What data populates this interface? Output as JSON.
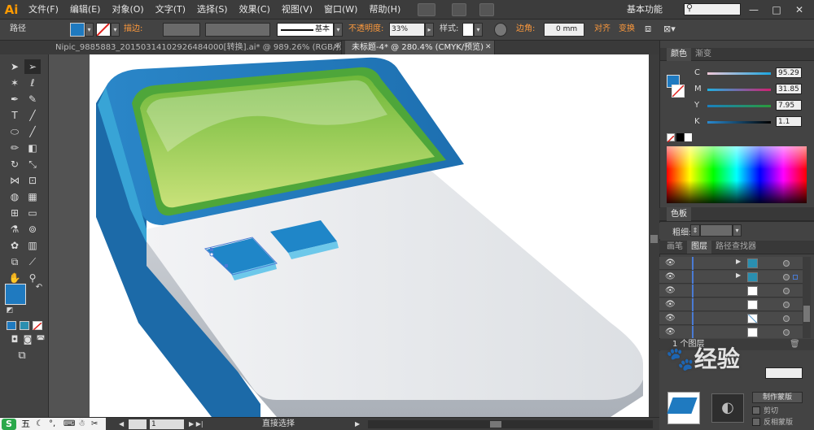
{
  "app": {
    "logo": "Ai",
    "workspace": "基本功能"
  },
  "menu": [
    "文件(F)",
    "编辑(E)",
    "对象(O)",
    "文字(T)",
    "选择(S)",
    "效果(C)",
    "视图(V)",
    "窗口(W)",
    "帮助(H)"
  ],
  "window": {
    "minimize": "—",
    "maximize": "□",
    "close": "✕"
  },
  "control": {
    "selection_type": "路径",
    "stroke_label": "描边:",
    "stroke_style": "基本",
    "opacity_label": "不透明度:",
    "opacity_value": "33%",
    "style_label": "样式:",
    "corner_label": "边角:",
    "corner_value": "0 mm",
    "align_label": "对齐",
    "transform_label": "变换",
    "fill_color": "#1f7ac0"
  },
  "tabs": [
    {
      "label": "Nipic_9885883_20150314102926484000[转换].ai* @ 989.26% (RGB/预览)",
      "close": "✕"
    },
    {
      "label": "未标题-4* @ 280.4% (CMYK/预览)",
      "close": "✕"
    }
  ],
  "color_panel": {
    "tabs": [
      "颜色",
      "渐变"
    ],
    "channels": [
      {
        "label": "C",
        "value": "95.29",
        "level": 0.95
      },
      {
        "label": "M",
        "value": "31.85",
        "level": 0.32
      },
      {
        "label": "Y",
        "value": "7.95",
        "level": 0.08
      },
      {
        "label": "K",
        "value": "1.1",
        "level": 0.01
      }
    ],
    "fill_color": "#1f7ac0"
  },
  "swatch_panel": {
    "title": "色板"
  },
  "stroke_panel": {
    "title": "描边",
    "weight_label": "粗细:"
  },
  "layers_panel": {
    "tabs": [
      "画笔",
      "图层",
      "路径查找器"
    ],
    "rows": [
      {
        "name": ""
      },
      {
        "name": ""
      },
      {
        "name": ""
      },
      {
        "name": ""
      },
      {
        "name": ""
      },
      {
        "name": ""
      }
    ],
    "footer": "1 个图层"
  },
  "bottom_panel": {
    "cut_label": "剪切",
    "invert_label": "反相蒙版",
    "make_mask": "制作蒙版"
  },
  "watermark": {
    "text": "经验"
  },
  "status": {
    "tool_name": "直接选择",
    "zoom": "280.4%",
    "page": "1"
  },
  "taskbar": {
    "ime": "五"
  }
}
